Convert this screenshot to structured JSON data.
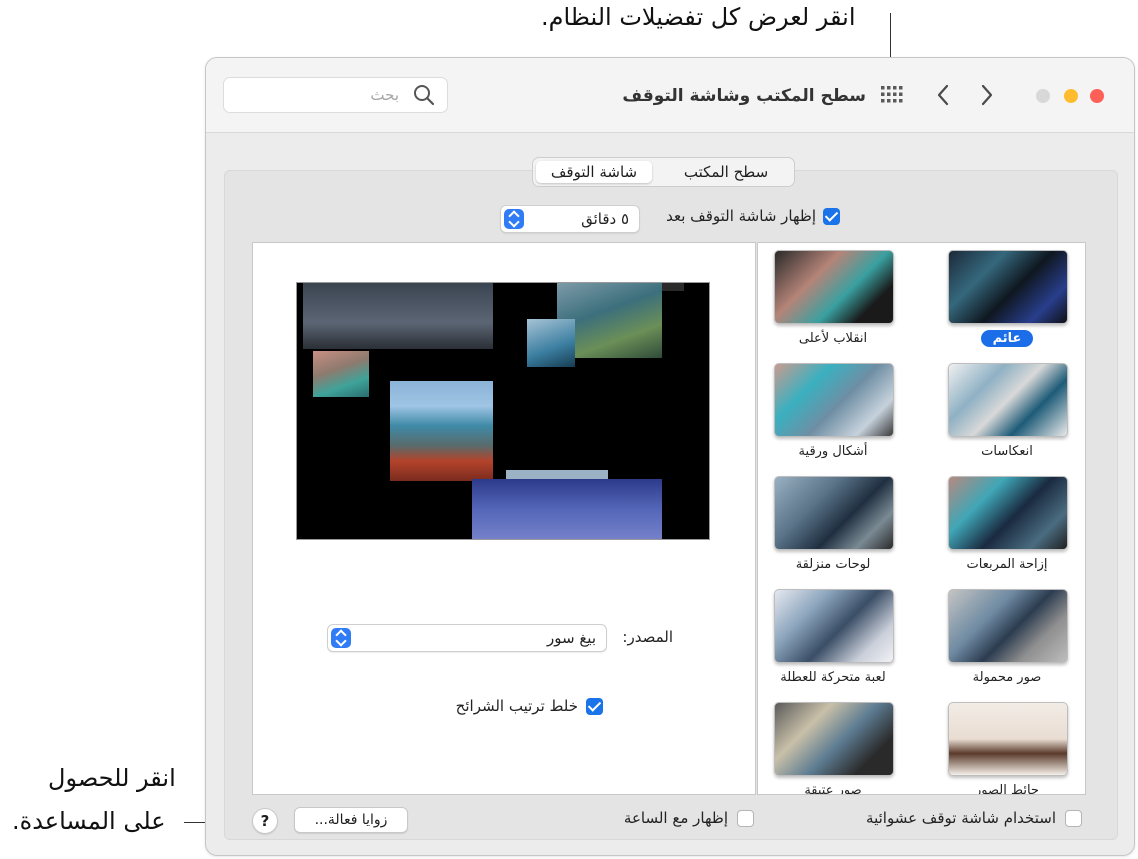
{
  "callouts": {
    "top": "انقر لعرض كل تفضيلات النظام.",
    "help_line1": "انقر للحصول",
    "help_line2": "على المساعدة."
  },
  "window": {
    "title": "سطح المكتب وشاشة التوقف",
    "search_placeholder": "بحث",
    "icons": {
      "back": "chevron-left-icon",
      "forward": "chevron-right-icon",
      "grid": "grid-icon",
      "search": "search-icon",
      "help": "question-icon"
    },
    "traffic_lights": {
      "close": "#fe5f57",
      "minimize": "#febc2e",
      "zoom": "#d8d8d8"
    }
  },
  "tabs": [
    {
      "label": "سطح المكتب",
      "selected": false
    },
    {
      "label": "شاشة التوقف",
      "selected": true
    }
  ],
  "show_after": {
    "label": "إظهار شاشة التوقف بعد",
    "checked": true,
    "value": "٥ دقائق"
  },
  "source": {
    "label": "المصدر:",
    "value": "بيغ سور"
  },
  "shuffle": {
    "label": "خلط ترتيب الشرائح",
    "checked": true
  },
  "screensavers": [
    {
      "name": "عائم",
      "selected": true
    },
    {
      "name": "انقلاب لأعلى",
      "selected": false
    },
    {
      "name": "انعكاسات",
      "selected": false
    },
    {
      "name": "أشكال ورقية",
      "selected": false
    },
    {
      "name": "إزاحة المربعات",
      "selected": false
    },
    {
      "name": "لوحات منزلقة",
      "selected": false
    },
    {
      "name": "صور محمولة",
      "selected": false
    },
    {
      "name": "لعبة متحركة للعطلة",
      "selected": false
    },
    {
      "name": "حائط الصور",
      "selected": false
    },
    {
      "name": "صور عتيقة",
      "selected": false
    }
  ],
  "footer": {
    "random_label": "استخدام شاشة توقف عشوائية",
    "random_checked": false,
    "clock_label": "إظهار مع الساعة",
    "clock_checked": false,
    "hot_corners": "زوايا فعالة...",
    "help": "?"
  },
  "accent": "#1a73e8"
}
